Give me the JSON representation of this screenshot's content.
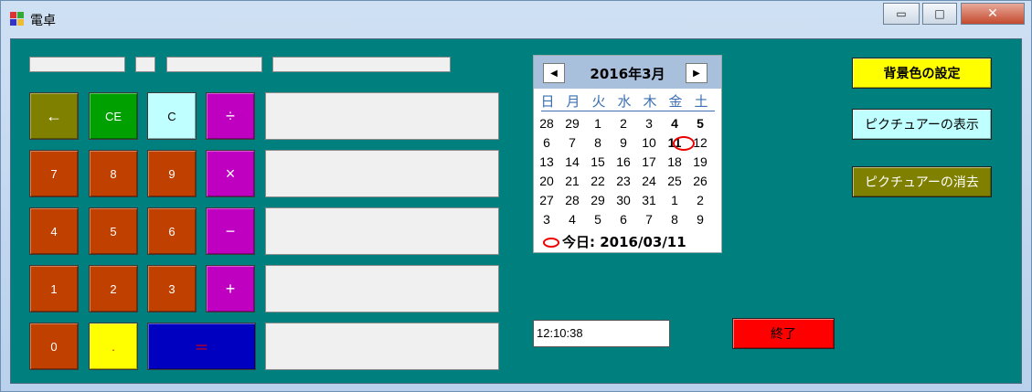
{
  "window": {
    "title": "電卓",
    "minimize": "▭",
    "maximize": "□",
    "close": "✕"
  },
  "top_fields": [
    "",
    "",
    "",
    ""
  ],
  "buttons": {
    "back": "←",
    "ce": "CE",
    "c": "C",
    "div": "÷",
    "seven": "7",
    "eight": "8",
    "nine": "9",
    "mul": "×",
    "four": "4",
    "five": "5",
    "six": "6",
    "sub": "−",
    "one": "1",
    "two": "2",
    "three": "3",
    "add": "+",
    "zero": "0",
    "dot": ".",
    "eq": "＝"
  },
  "displays": [
    "",
    "",
    "",
    "",
    ""
  ],
  "calendar": {
    "month": "2016年3月",
    "prev": "◀",
    "next": "▶",
    "weekdays": [
      "日",
      "月",
      "火",
      "水",
      "木",
      "金",
      "土"
    ],
    "weeks": [
      [
        "28",
        "29",
        "1",
        "2",
        "3",
        "4",
        "5"
      ],
      [
        "6",
        "7",
        "8",
        "9",
        "10",
        "11",
        "12"
      ],
      [
        "13",
        "14",
        "15",
        "16",
        "17",
        "18",
        "19"
      ],
      [
        "20",
        "21",
        "22",
        "23",
        "24",
        "25",
        "26"
      ],
      [
        "27",
        "28",
        "29",
        "30",
        "31",
        "1",
        "2"
      ],
      [
        "3",
        "4",
        "5",
        "6",
        "7",
        "8",
        "9"
      ]
    ],
    "today_label": "今日: 2016/03/11"
  },
  "right_buttons": {
    "bg_color": "背景色の設定",
    "show_picture": "ピクチュアーの表示",
    "clear_picture": "ピクチュアーの消去",
    "exit": "終了"
  },
  "clock": "12:10:38",
  "colors": {
    "client_bg": "#007f7f",
    "back_btn": "#808000",
    "ce_btn": "#00a000",
    "c_btn": "#c0ffff",
    "op_btn": "#c000c0",
    "num_btn": "#c04000",
    "dot_btn": "#ffff00",
    "eq_btn": "#0000c0",
    "bg_btn": "#ffff00",
    "show_btn": "#c0ffff",
    "clear_btn": "#808000",
    "exit_btn": "#ff0000"
  }
}
